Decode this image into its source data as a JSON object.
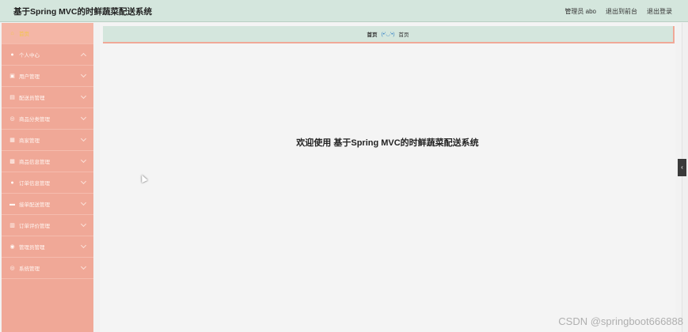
{
  "header": {
    "title": "基于Spring MVC的时鲜蔬菜配送系统",
    "user_label": "管理员 abo",
    "to_frontend": "退出到前台",
    "logout": "退出登录"
  },
  "sidebar": {
    "items": [
      {
        "label": "首页",
        "icon": "home-icon",
        "glyph": "⌂",
        "active": true,
        "expandable": false
      },
      {
        "label": "个人中心",
        "icon": "user-icon",
        "glyph": "●",
        "active": false,
        "expandable": true,
        "expanded": true
      },
      {
        "label": "用户管理",
        "icon": "users-icon",
        "glyph": "▣",
        "active": false,
        "expandable": true
      },
      {
        "label": "配送员管理",
        "icon": "courier-icon",
        "glyph": "▤",
        "active": false,
        "expandable": true
      },
      {
        "label": "商品分类管理",
        "icon": "category-icon",
        "glyph": "◎",
        "active": false,
        "expandable": true
      },
      {
        "label": "商家管理",
        "icon": "store-icon",
        "glyph": "▦",
        "active": false,
        "expandable": true
      },
      {
        "label": "商品信息管理",
        "icon": "goods-icon",
        "glyph": "▩",
        "active": false,
        "expandable": true
      },
      {
        "label": "订单信息管理",
        "icon": "order-icon",
        "glyph": "●",
        "active": false,
        "expandable": true
      },
      {
        "label": "接单配送管理",
        "icon": "delivery-icon",
        "glyph": "▬",
        "active": false,
        "expandable": true
      },
      {
        "label": "订单评价管理",
        "icon": "review-icon",
        "glyph": "▥",
        "active": false,
        "expandable": true
      },
      {
        "label": "管理员管理",
        "icon": "admin-icon",
        "glyph": "◉",
        "active": false,
        "expandable": true
      },
      {
        "label": "系统管理",
        "icon": "settings-icon",
        "glyph": "◎",
        "active": false,
        "expandable": true
      }
    ]
  },
  "breadcrumb": {
    "home": "首页",
    "separator": "(•'◡'•)",
    "current": "首页"
  },
  "main": {
    "welcome": "欢迎使用 基于Spring MVC的时鲜蔬菜配送系统"
  },
  "side_tab": {
    "glyph": "‹"
  },
  "watermark": "CSDN @springboot666888",
  "colors": {
    "header_bg": "#d4e6dd",
    "sidebar_bg": "#f0a897",
    "active_text": "#f2c64a",
    "content_bg": "#f4f4f4"
  }
}
